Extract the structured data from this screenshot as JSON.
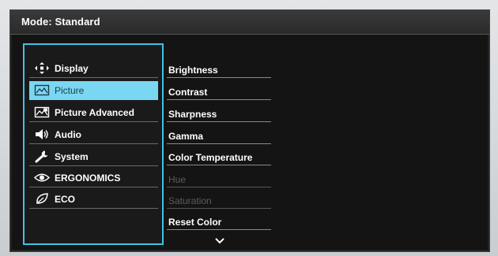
{
  "header": {
    "title": "Mode: Standard"
  },
  "menu": {
    "items": [
      {
        "label": "Display",
        "icon": "display-move-icon"
      },
      {
        "label": "Picture",
        "icon": "picture-icon",
        "selected": true
      },
      {
        "label": "Picture Advanced",
        "icon": "picture-advanced-icon"
      },
      {
        "label": "Audio",
        "icon": "speaker-icon"
      },
      {
        "label": "System",
        "icon": "wrench-icon"
      },
      {
        "label": "ERGONOMICS",
        "icon": "eye-icon"
      },
      {
        "label": "ECO",
        "icon": "leaf-icon"
      }
    ]
  },
  "submenu": {
    "items": [
      {
        "label": "Brightness",
        "enabled": true
      },
      {
        "label": "Contrast",
        "enabled": true
      },
      {
        "label": "Sharpness",
        "enabled": true
      },
      {
        "label": "Gamma",
        "enabled": true
      },
      {
        "label": "Color Temperature",
        "enabled": true
      },
      {
        "label": "Hue",
        "enabled": false
      },
      {
        "label": "Saturation",
        "enabled": false
      },
      {
        "label": "Reset Color",
        "enabled": true
      }
    ],
    "more_indicator": "chevron-down-icon"
  },
  "colors": {
    "accent": "#3fc2e6",
    "selected_bg": "#7ad7f2",
    "background": "#141414",
    "disabled_text": "#5c5c5c"
  }
}
